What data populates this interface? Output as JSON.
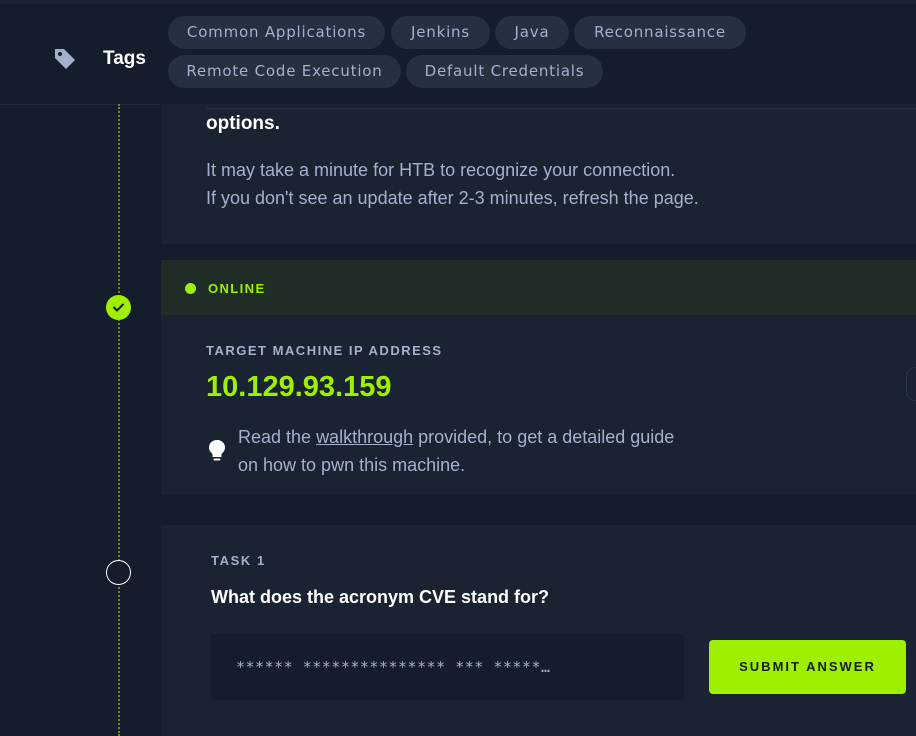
{
  "tags": {
    "title": "Tags",
    "items": [
      "Common Applications",
      "Jenkins",
      "Java",
      "Reconnaissance",
      "Remote Code Execution",
      "Default Credentials"
    ]
  },
  "connection": {
    "options_text": "options.",
    "line1": "It may take a minute for HTB to recognize your connection.",
    "line2": "If you don't see an update after 2-3 minutes, refresh the page."
  },
  "machine": {
    "status": "ONLINE",
    "ip_label": "TARGET MACHINE IP ADDRESS",
    "ip_value": "10.129.93.159",
    "walkthrough_prefix": "Read the ",
    "walkthrough_link": "walkthrough",
    "walkthrough_suffix": " provided, to get a detailed guide on how to pwn this machine."
  },
  "task": {
    "label": "TASK 1",
    "question": "What does the acronym CVE stand for?",
    "answer_mask": "****** *************** *** *****…",
    "submit_label": "SUBMIT ANSWER"
  },
  "colors": {
    "accent": "#9fef00",
    "background": "#141d2b",
    "card": "#1a2332",
    "pill": "#253041",
    "text": "#a4b1cd"
  },
  "icons": [
    "tag-icon",
    "check-icon",
    "lightbulb-icon"
  ]
}
